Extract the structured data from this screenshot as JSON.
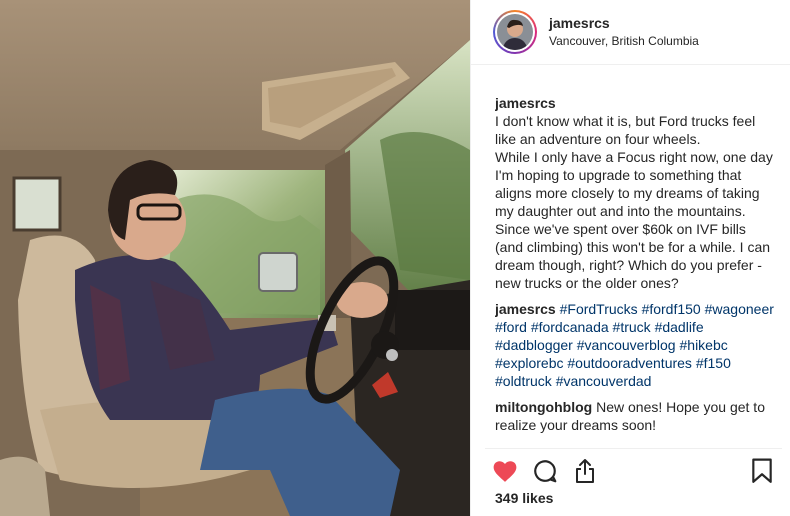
{
  "post": {
    "username": "jamesrcs",
    "location": "Vancouver, British Columbia",
    "caption": {
      "username": "jamesrcs",
      "text": "I don't know what it is, but Ford trucks feel like an adventure on four wheels.\nWhile I only have a Focus right now, one day I'm hoping to upgrade to something that aligns more closely to my dreams of taking my daughter out and into the mountains. Since we've spent over $60k on IVF bills (and climbing) this won't be for a while. I can dream though, right? Which do you prefer - new trucks or the older ones?"
    },
    "hashtag_comment": {
      "username": "jamesrcs",
      "tags": [
        "#FordTrucks",
        "#fordf150",
        "#wagoneer",
        "#ford",
        "#fordcanada",
        "#truck",
        "#dadlife",
        "#dadblogger",
        "#vancouverblog",
        "#hikebc",
        "#explorebc",
        "#outdooradventures",
        "#f150",
        "#oldtruck",
        "#vancouverdad"
      ]
    },
    "reply_comment": {
      "username": "miltongohblog",
      "text": "New ones! Hope you get to realize your dreams soon!"
    },
    "likes_text": "349 likes"
  },
  "icons": {
    "like": "heart-icon",
    "comment": "comment-icon",
    "share": "share-icon",
    "save": "bookmark-icon"
  },
  "colors": {
    "heart": "#ed4956",
    "hashtag": "#003569"
  }
}
